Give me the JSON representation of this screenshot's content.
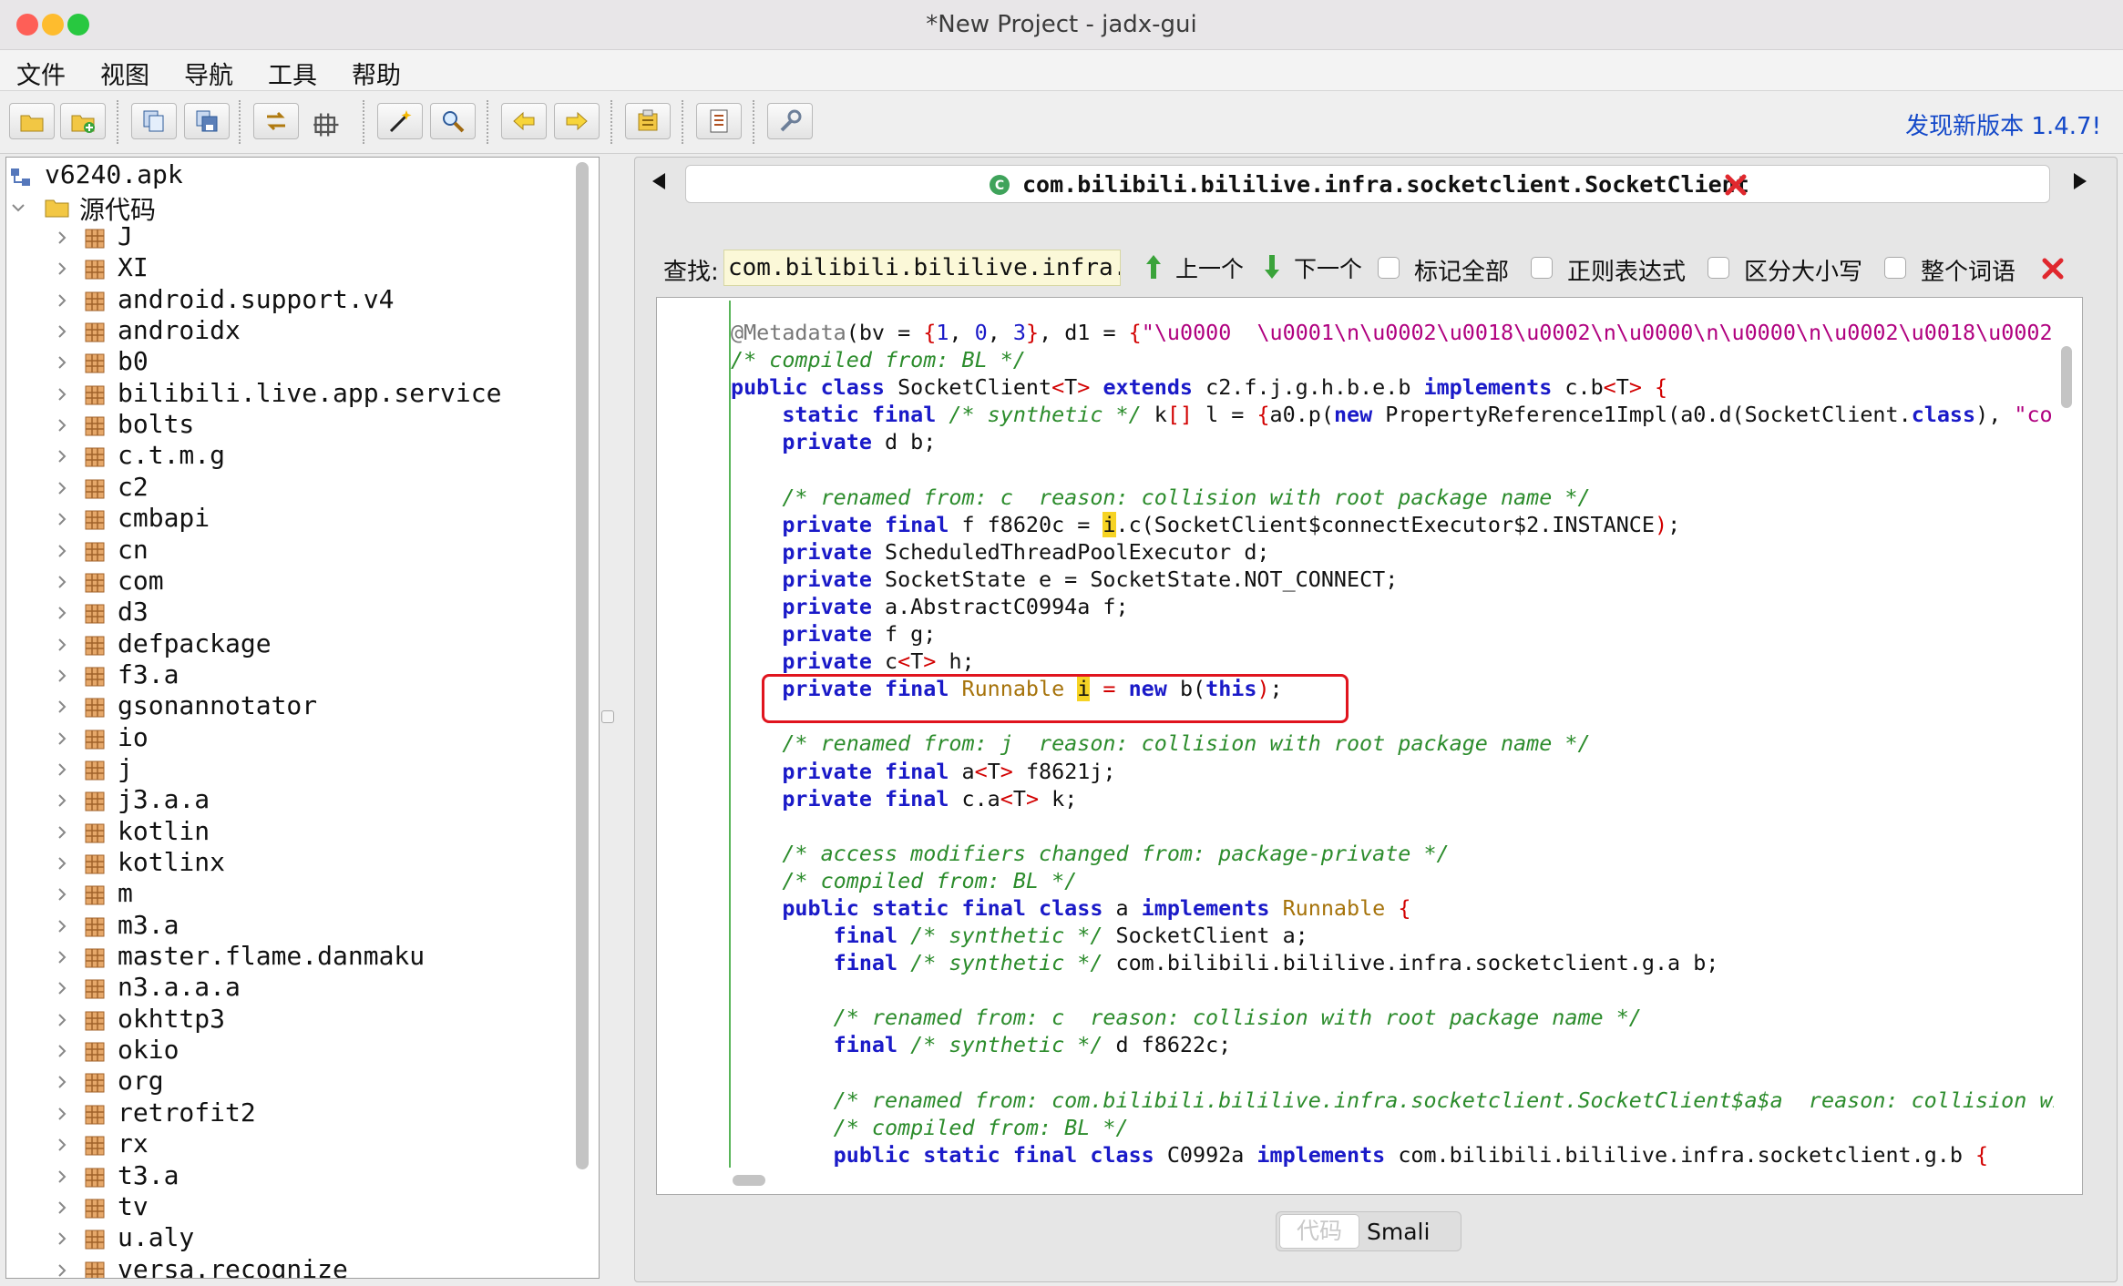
{
  "window": {
    "title": "*New Project - jadx-gui"
  },
  "menu": [
    "文件",
    "视图",
    "导航",
    "工具",
    "帮助"
  ],
  "toolbar": {
    "buttons": [
      "open-file-icon",
      "add-file-icon",
      "copy-icon",
      "save-all-icon",
      "sync-icon",
      "flatten-packages-icon",
      "magic-wand-icon",
      "search-icon",
      "back-arrow-icon",
      "forward-arrow-icon",
      "decompile-all-icon",
      "log-viewer-icon",
      "settings-wrench-icon"
    ],
    "new_version": "发现新版本 1.4.7!"
  },
  "tree": {
    "root": "v6240.apk",
    "source": "源代码",
    "packages": [
      "J",
      "XI",
      "android.support.v4",
      "androidx",
      "b0",
      "bilibili.live.app.service",
      "bolts",
      "c.t.m.g",
      "c2",
      "cmbapi",
      "cn",
      "com",
      "d3",
      "defpackage",
      "f3.a",
      "gsonannotator",
      "io",
      "j",
      "j3.a.a",
      "kotlin",
      "kotlinx",
      "m",
      "m3.a",
      "master.flame.danmaku",
      "n3.a.a.a",
      "okhttp3",
      "okio",
      "org",
      "retrofit2",
      "rx",
      "t3.a",
      "tv",
      "u.aly",
      "versa.recognize"
    ]
  },
  "tab": {
    "title": "com.bilibili.bililive.infra.socketclient.SocketClient"
  },
  "search": {
    "label": "查找:",
    "value": "com.bilibili.bililive.infra.socketclie",
    "prev": "上一个",
    "next": "下一个",
    "mark_all": "标记全部",
    "regex": "正则表达式",
    "case": "区分大小写",
    "whole_word": "整个词语"
  },
  "view_tabs": {
    "code": "代码",
    "smali": "Smali"
  },
  "colors": {
    "accent_link": "#1449c9",
    "highlight_box": "#e0141e",
    "search_highlight": "#f6d324"
  }
}
